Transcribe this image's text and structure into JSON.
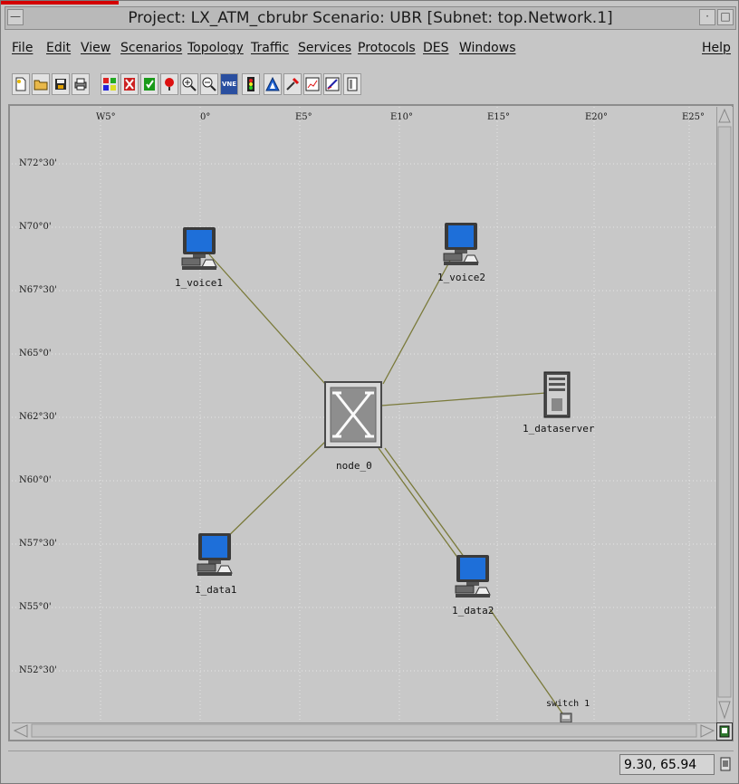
{
  "window": {
    "title": "Project: LX_ATM_cbrubr Scenario: UBR  [Subnet: top.Network.1]"
  },
  "menubar": {
    "items": [
      {
        "label": "File"
      },
      {
        "label": "Edit"
      },
      {
        "label": "View"
      },
      {
        "label": "Scenarios"
      },
      {
        "label": "Topology"
      },
      {
        "label": "Traffic"
      },
      {
        "label": "Services"
      },
      {
        "label": "Protocols"
      },
      {
        "label": "DES"
      },
      {
        "label": "Windows"
      }
    ],
    "help_label": "Help"
  },
  "toolbar": {
    "tools": [
      {
        "name": "new-icon"
      },
      {
        "name": "open-icon"
      },
      {
        "name": "save-icon"
      },
      {
        "name": "print-icon"
      },
      {
        "name": "object-palette-icon"
      },
      {
        "name": "fail-node-icon"
      },
      {
        "name": "recover-node-icon"
      },
      {
        "name": "return-to-parent-icon"
      },
      {
        "name": "zoom-in-icon"
      },
      {
        "name": "zoom-out-icon"
      },
      {
        "name": "vne-icon",
        "label": "VNE"
      },
      {
        "name": "traffic-light-icon"
      },
      {
        "name": "configure-run-icon"
      },
      {
        "name": "view-results-icon"
      },
      {
        "name": "report-icon"
      },
      {
        "name": "graph-icon"
      },
      {
        "name": "panel-icon"
      }
    ]
  },
  "map": {
    "longitude_labels": [
      "W5°",
      "0°",
      "E5°",
      "E10°",
      "E15°",
      "E20°",
      "E25°"
    ],
    "latitude_labels": [
      "N72°30'",
      "N70°0'",
      "N67°30'",
      "N65°0'",
      "N62°30'",
      "N60°0'",
      "N57°30'",
      "N55°0'",
      "N52°30'"
    ],
    "nodes": {
      "voice1": "1_voice1",
      "voice2": "1_voice2",
      "dataserver": "1_dataserver",
      "switch": "node_0",
      "data1": "1_data1",
      "data2": "1_data2",
      "switch1": "switch 1"
    }
  },
  "status": {
    "coordinates": "9.30, 65.94"
  },
  "colors": {
    "link": "#7a7a3a",
    "screen": "#1e6fd9",
    "background": "#c8c8c8"
  }
}
